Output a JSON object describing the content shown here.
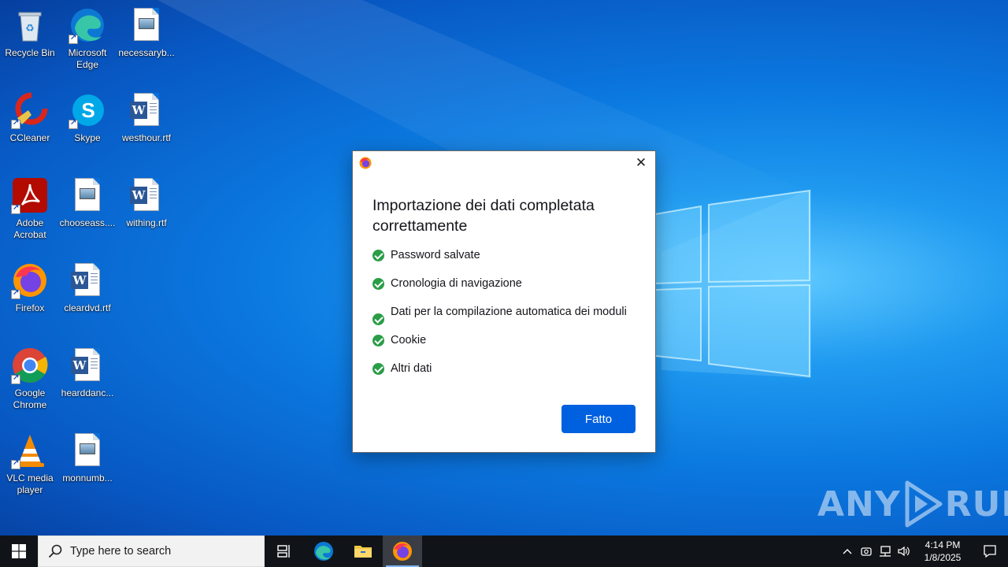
{
  "desktop": {
    "icons": [
      {
        "label": "Recycle Bin"
      },
      {
        "label": "Microsoft Edge"
      },
      {
        "label": "necessaryb..."
      },
      {
        "label": "CCleaner"
      },
      {
        "label": "Skype"
      },
      {
        "label": "westhour.rtf"
      },
      {
        "label": "Adobe Acrobat"
      },
      {
        "label": "chooseass...."
      },
      {
        "label": "withing.rtf"
      },
      {
        "label": "Firefox"
      },
      {
        "label": "cleardvd.rtf"
      },
      {
        "label": "Google Chrome"
      },
      {
        "label": "hearddanc..."
      },
      {
        "label": "VLC media player"
      },
      {
        "label": "monnumb..."
      }
    ]
  },
  "dialog": {
    "title": "Importazione dei dati completata correttamente",
    "items": [
      "Password salvate",
      "Cronologia di navigazione",
      "Dati per la compilazione automatica dei moduli",
      "Cookie",
      "Altri dati"
    ],
    "done_label": "Fatto",
    "close_glyph": "✕"
  },
  "watermark": {
    "left": "ANY",
    "right": "RUN"
  },
  "taskbar": {
    "search_placeholder": "Type here to search",
    "clock_time": "4:14 PM",
    "clock_date": "1/8/2025"
  },
  "colors": {
    "accent": "#0061e0",
    "check": "#2a9d47",
    "taskbar": "#101418"
  }
}
